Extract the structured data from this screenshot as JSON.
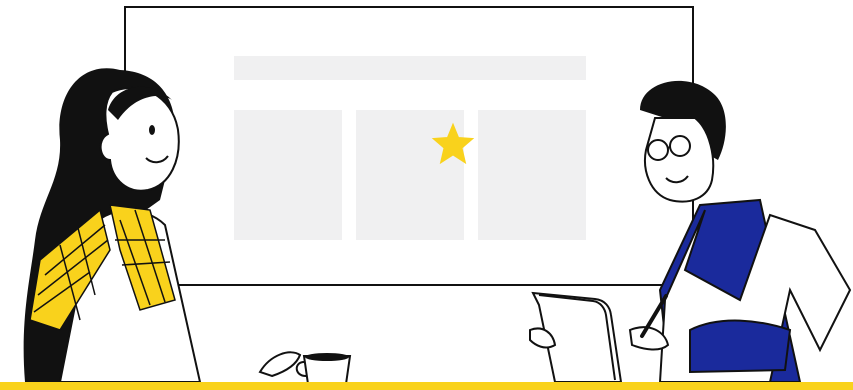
{
  "scene": {
    "description_free": true,
    "colors": {
      "outline": "#111111",
      "board_fill": "#ffffff",
      "placeholder_fill": "#f0f0f1",
      "accent_yellow": "#f9d21c",
      "shirt_blue": "#1a2a9c",
      "hair": "#111111",
      "skin": "#ffffff"
    },
    "icons": [
      "star-icon",
      "coffee-cup-icon",
      "tablet-icon",
      "pen-icon",
      "glasses-icon"
    ]
  }
}
